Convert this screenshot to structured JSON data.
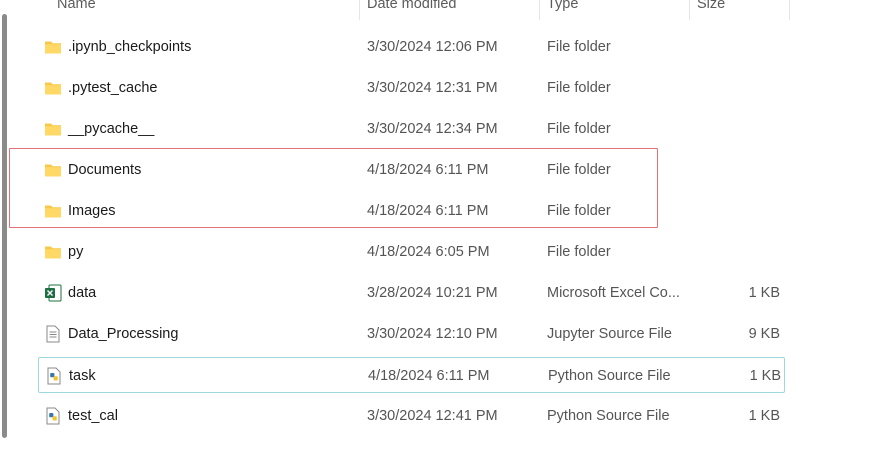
{
  "columns": {
    "name": "Name",
    "date_modified": "Date modified",
    "type": "Type",
    "size": "Size"
  },
  "rows": [
    {
      "name": ".ipynb_checkpoints",
      "date": "3/30/2024 12:06 PM",
      "type": "File folder",
      "size": "",
      "icon": "folder-icon"
    },
    {
      "name": ".pytest_cache",
      "date": "3/30/2024 12:31 PM",
      "type": "File folder",
      "size": "",
      "icon": "folder-icon"
    },
    {
      "name": "__pycache__",
      "date": "3/30/2024 12:34 PM",
      "type": "File folder",
      "size": "",
      "icon": "folder-icon"
    },
    {
      "name": "Documents",
      "date": "4/18/2024 6:11 PM",
      "type": "File folder",
      "size": "",
      "icon": "folder-icon"
    },
    {
      "name": "Images",
      "date": "4/18/2024 6:11 PM",
      "type": "File folder",
      "size": "",
      "icon": "folder-icon"
    },
    {
      "name": "py",
      "date": "4/18/2024 6:05 PM",
      "type": "File folder",
      "size": "",
      "icon": "folder-icon"
    },
    {
      "name": "data",
      "date": "3/28/2024 10:21 PM",
      "type": "Microsoft Excel Co...",
      "size": "1 KB",
      "icon": "excel-file-icon"
    },
    {
      "name": "Data_Processing",
      "date": "3/30/2024 12:10 PM",
      "type": "Jupyter Source File",
      "size": "9 KB",
      "icon": "text-file-icon"
    },
    {
      "name": "task",
      "date": "4/18/2024 6:11 PM",
      "type": "Python Source File",
      "size": "1 KB",
      "icon": "python-file-icon"
    },
    {
      "name": "test_cal",
      "date": "3/30/2024 12:41 PM",
      "type": "Python Source File",
      "size": "1 KB",
      "icon": "python-file-icon"
    }
  ],
  "colors": {
    "folder": "#f7c948",
    "highlight_border": "#e3717a",
    "focus_border": "#9fd7de",
    "excel": "#1d6f42"
  }
}
